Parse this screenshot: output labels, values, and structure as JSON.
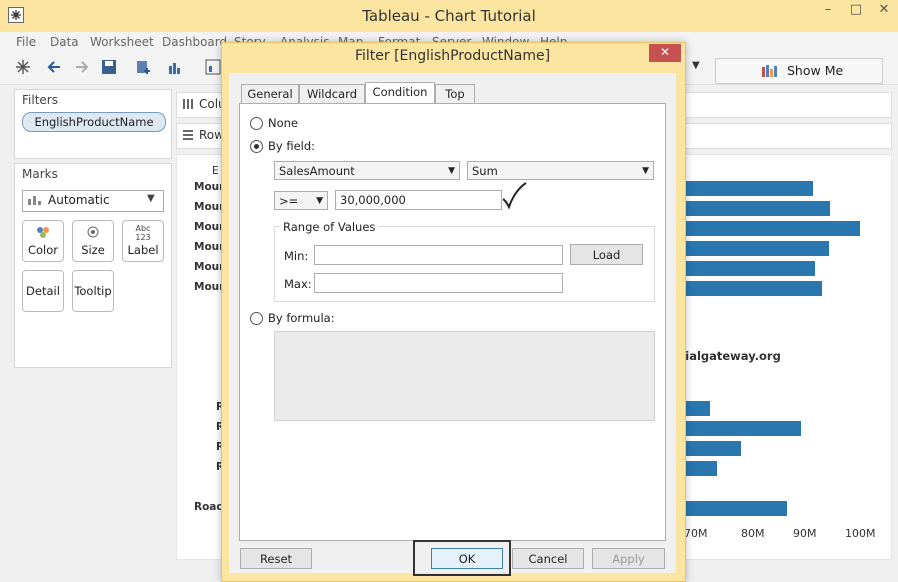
{
  "window": {
    "title": "Tableau - Chart Tutorial",
    "controls": [
      "–",
      "□",
      "✕"
    ]
  },
  "menu": [
    "File",
    "Data",
    "Worksheet",
    "Dashboard",
    "Story",
    "Analysis",
    "Map",
    "Format",
    "Server",
    "Window",
    "Help"
  ],
  "toolbar": {
    "show_me_label": "Show Me"
  },
  "filters": {
    "title": "Filters",
    "pill": "EnglishProductName"
  },
  "marks": {
    "title": "Marks",
    "type": "Automatic",
    "buttons": [
      {
        "label": "Color",
        "icon": "color-icon"
      },
      {
        "label": "Size",
        "icon": "size-icon"
      },
      {
        "label": "Label",
        "icon": "label-icon",
        "glyph": "Abc\n123"
      },
      {
        "label": "Detail",
        "icon": "detail-icon"
      },
      {
        "label": "Tooltip",
        "icon": "tooltip-icon"
      }
    ]
  },
  "shelves": {
    "columns": "Colu",
    "rows": "Row"
  },
  "chart": {
    "header": "E",
    "row_labels": [
      "Moun",
      "Moun",
      "Moun",
      "Moun",
      "Moun",
      "Moun",
      "R",
      "R",
      "R",
      "R",
      "Roac"
    ],
    "bars_visible_end": [
      0.73,
      0.83,
      1.0,
      0.82,
      0.74,
      0.78,
      0.14,
      0.66,
      0.32,
      0.18,
      0.58
    ],
    "x_ticks": [
      "70M",
      "80M",
      "90M",
      "100M"
    ],
    "bar_color": "#2a77b0",
    "watermark": "©tutorialgateway.org"
  },
  "dialog": {
    "title": "Filter [EnglishProductName]",
    "close": "✕",
    "tabs": [
      "General",
      "Wildcard",
      "Condition",
      "Top"
    ],
    "active_tab": "Condition",
    "none_label": "None",
    "by_field_label": "By field:",
    "field": "SalesAmount",
    "aggregation": "Sum",
    "operator": ">=",
    "value": "30,000,000",
    "range_title": "Range of Values",
    "min_label": "Min:",
    "max_label": "Max:",
    "min_value": "",
    "max_value": "",
    "load_button": "Load",
    "by_formula_label": "By formula:",
    "reset_button": "Reset",
    "ok_button": "OK",
    "cancel_button": "Cancel",
    "apply_button": "Apply"
  }
}
